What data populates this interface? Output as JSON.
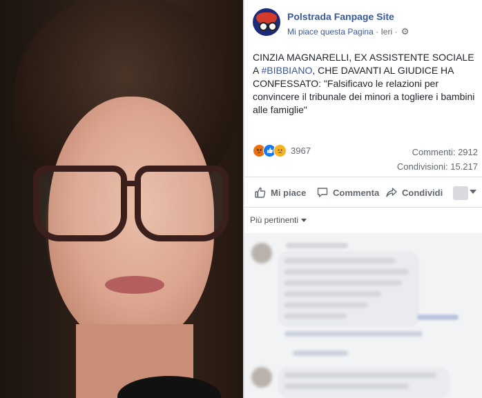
{
  "post": {
    "page_name": "Polstrada Fanpage Site",
    "like_page": "Mi piace questa Pagina",
    "separator": "·",
    "time": "Ieri",
    "text_part1": "CINZIA MAGNARELLI, EX ASSISTENTE SOCIALE A ",
    "hashtag": "#BIBBIANO",
    "text_part2": ", CHE DAVANTI AL GIUDICE HA CONFESSATO: \"Falsificavo le relazioni per convincere il tribunale dei minori a togliere i bambini alle famiglie\""
  },
  "reactions": {
    "count": "3967",
    "types": [
      "angry-icon",
      "like-icon",
      "sad-icon"
    ]
  },
  "stats": {
    "comments": "Commenti: 2912",
    "shares": "Condivisioni: 15.217"
  },
  "actions": {
    "like": "Mi piace",
    "comment": "Commenta",
    "share": "Condividi"
  },
  "comments": {
    "sort_label": "Più pertinenti"
  },
  "colors": {
    "link": "#385898",
    "secondary_text": "#616770",
    "divider": "#dadde1"
  }
}
